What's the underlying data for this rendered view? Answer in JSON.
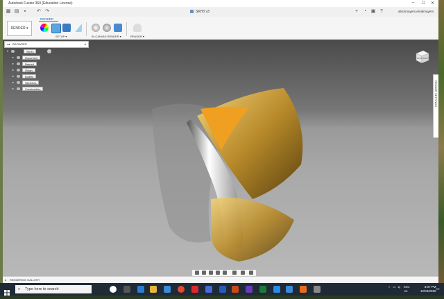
{
  "window": {
    "title": "Autodesk Fusion 360 (Education License)"
  },
  "document": {
    "tab_name": "SKH3 v3"
  },
  "user": {
    "name": "alinzimayem.erndimayem"
  },
  "toolbar": {
    "workspace_button": "RENDER ▾",
    "render_tab": "RENDER",
    "groups": [
      {
        "label": "SETUP ▾"
      },
      {
        "label": "IN-CANVAS RENDER ▾"
      },
      {
        "label": "RENDER ▾"
      }
    ]
  },
  "browser": {
    "header": "BROWSER",
    "root_label": "SKH3 v3",
    "items": [
      {
        "label": "Document Settings"
      },
      {
        "label": "Named Views"
      },
      {
        "label": "Origin"
      },
      {
        "label": "Bodies"
      },
      {
        "label": "Sketches"
      },
      {
        "label": "Construction"
      }
    ]
  },
  "viewcube": {
    "front": "FRONT",
    "right": "RIGHT"
  },
  "side_panel": {
    "label": "RENDER SETTINGS"
  },
  "gallery": {
    "label": "RENDERING GALLERY"
  },
  "taskbar": {
    "search_placeholder": "Type here to search",
    "lang": "ENG",
    "region": "US",
    "time": "3:07 PM",
    "date": "12/04/2020"
  },
  "colors": {
    "accent": "#2a6fb3",
    "taskbar": "#1e2a36",
    "gold": "#c9a23a"
  }
}
